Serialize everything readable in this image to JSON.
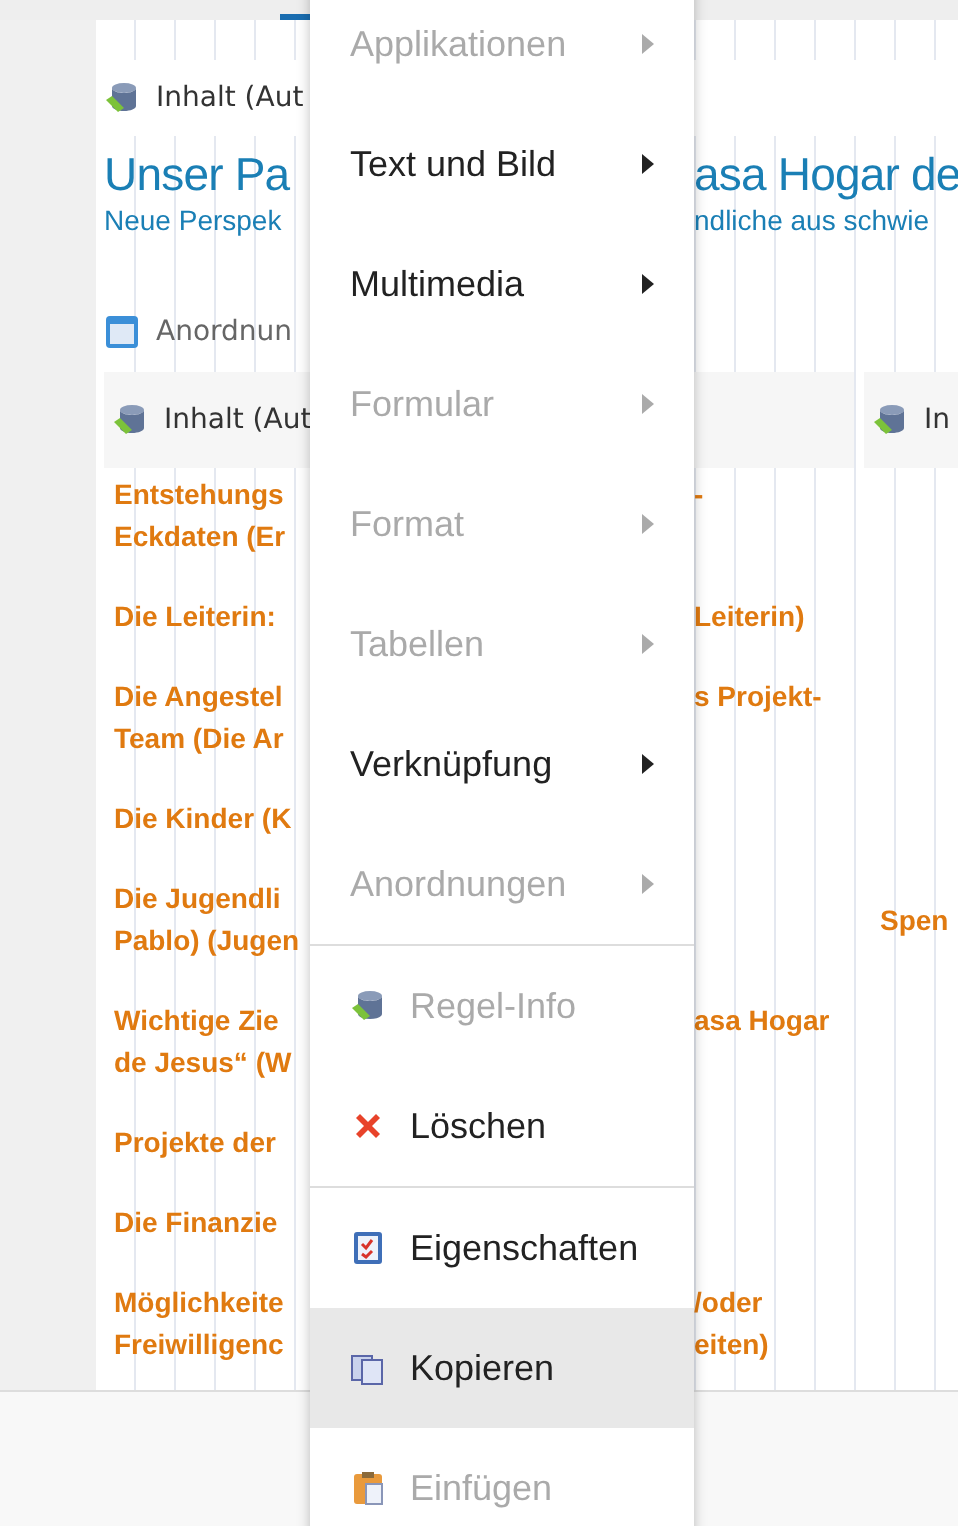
{
  "header": {
    "label": "Inhalt (Aut"
  },
  "heading": {
    "left": "Unser Pa",
    "right": "asa Hogar de"
  },
  "subheading": {
    "left": "Neue Perspek",
    "right": "ndliche aus schwie"
  },
  "arrangement": {
    "label": "Anordnun"
  },
  "column_header": {
    "left": "Inhalt (Aut",
    "right": "In"
  },
  "links": [
    {
      "left": "Entstehungs\nEckdaten (Er",
      "right": "-"
    },
    {
      "left": "Die Leiterin:",
      "right": "Leiterin)"
    },
    {
      "left": "Die Angestel\nTeam (Die Ar",
      "right": "s Projekt-"
    },
    {
      "left": "Die Kinder (K"
    },
    {
      "left": "Die Jugendli\nPablo) (Jugen",
      "side": "Spen"
    },
    {
      "left": "Wichtige Zie\nde Jesus“ (W",
      "right": "asa Hogar"
    },
    {
      "left": "Projekte der"
    },
    {
      "left": "Die Finanzie"
    },
    {
      "left": "Möglichkeite\nFreiwilligenc",
      "right": "/oder\neiten)"
    }
  ],
  "menu": {
    "items": [
      {
        "kind": "submenu",
        "label": "Applikationen",
        "disabled": true,
        "selected": false
      },
      {
        "kind": "submenu",
        "label": "Text und Bild",
        "disabled": false,
        "selected": false
      },
      {
        "kind": "submenu",
        "label": "Multimedia",
        "disabled": false,
        "selected": false
      },
      {
        "kind": "submenu",
        "label": "Formular",
        "disabled": true,
        "selected": false
      },
      {
        "kind": "submenu",
        "label": "Format",
        "disabled": true,
        "selected": false
      },
      {
        "kind": "submenu",
        "label": "Tabellen",
        "disabled": true,
        "selected": false
      },
      {
        "kind": "submenu",
        "label": "Verknüpfung",
        "disabled": false,
        "selected": false
      },
      {
        "kind": "submenu",
        "label": "Anordnungen",
        "disabled": true,
        "selected": false
      },
      {
        "kind": "separator"
      },
      {
        "kind": "action",
        "label": "Regel-Info",
        "disabled": true,
        "selected": false
      },
      {
        "kind": "action",
        "label": "Löschen",
        "disabled": false,
        "selected": false
      },
      {
        "kind": "separator"
      },
      {
        "kind": "action",
        "label": "Eigenschaften",
        "disabled": false,
        "selected": false
      },
      {
        "kind": "action",
        "label": "Kopieren",
        "disabled": false,
        "selected": true
      },
      {
        "kind": "action",
        "label": "Einfügen",
        "disabled": true,
        "selected": false
      }
    ]
  }
}
